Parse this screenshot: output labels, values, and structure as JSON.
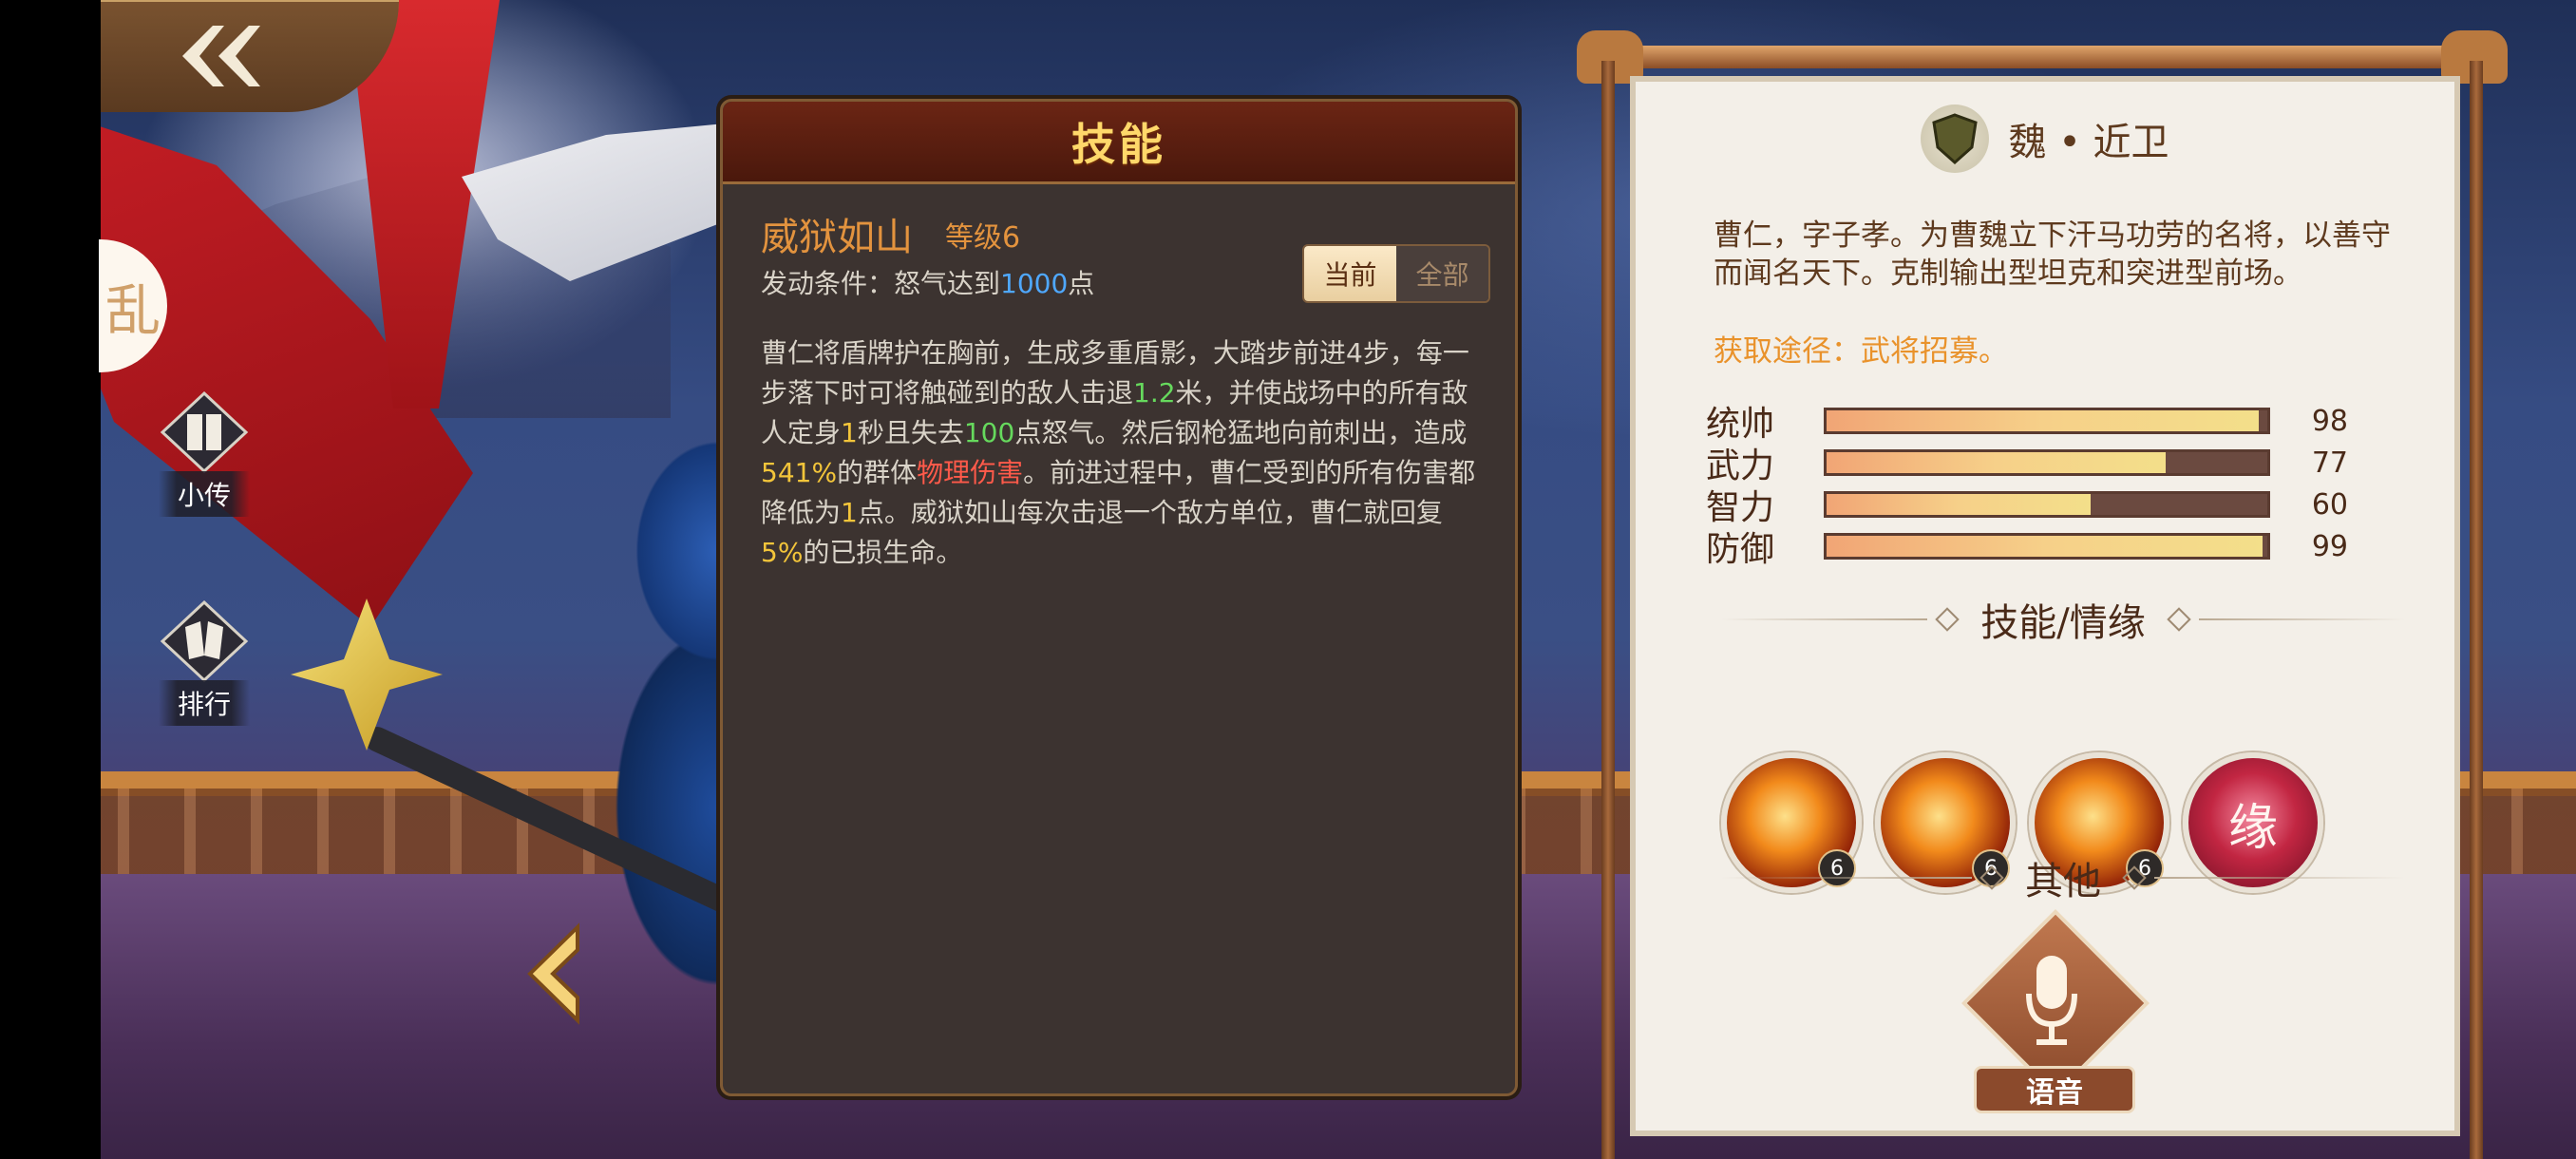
{
  "nav": {
    "side_glyph": "乱",
    "items": [
      {
        "label": "小传"
      },
      {
        "label": "排行"
      }
    ]
  },
  "skill_panel": {
    "title": "技能",
    "skill_name": "威狱如山",
    "level": "等级6",
    "condition_prefix": "发动条件：怒气达到",
    "condition_value": "1000",
    "condition_suffix": "点",
    "toggle": {
      "current": "当前",
      "all": "全部",
      "selected": "当前"
    },
    "desc": {
      "p1": "曹仁将盾牌护在胸前，生成多重盾影，大踏步前进4步，每一步落下时可将触碰到的敌人击退",
      "v1": "1.2",
      "p2": "米，并使战场中的所有敌人定身",
      "v2": "1",
      "p3": "秒且失去",
      "v3": "100",
      "p4": "点怒气。然后钢枪猛地向前刺出，造成",
      "v4": "541%",
      "p5": "的群体",
      "v5": "物理伤害",
      "p6": "。前进过程中，曹仁受到的所有伤害都降低为",
      "v6": "1",
      "p7": "点。威狱如山每次击退一个敌方单位，曹仁就回复",
      "v7": "5%",
      "p8": "的已损生命。"
    }
  },
  "info_panel": {
    "faction": "魏  •  近卫",
    "bio": "曹仁，字子孝。为曹魏立下汗马功劳的名将，以善守而闻名天下。克制输出型坦克和突进型前场。",
    "acquire": "获取途径：武将招募。",
    "stats": [
      {
        "name": "统帅",
        "value": 98
      },
      {
        "name": "武力",
        "value": 77
      },
      {
        "name": "智力",
        "value": 60
      },
      {
        "name": "防御",
        "value": 99
      }
    ],
    "skills_title": "技能/情缘",
    "skills": [
      {
        "icon": "skill-1-icon",
        "level": "6"
      },
      {
        "icon": "skill-2-icon",
        "level": "6"
      },
      {
        "icon": "skill-3-icon",
        "level": "6"
      },
      {
        "icon": "fate-icon",
        "glyph": "缘"
      }
    ],
    "other_title": "其他",
    "voice_label": "语音"
  },
  "colors": {
    "accent_orange": "#e3933e",
    "highlight_green": "#66d95d",
    "highlight_yellow": "#f3c53a",
    "highlight_red": "#ff5a4a",
    "highlight_blue": "#4fa8ff"
  }
}
